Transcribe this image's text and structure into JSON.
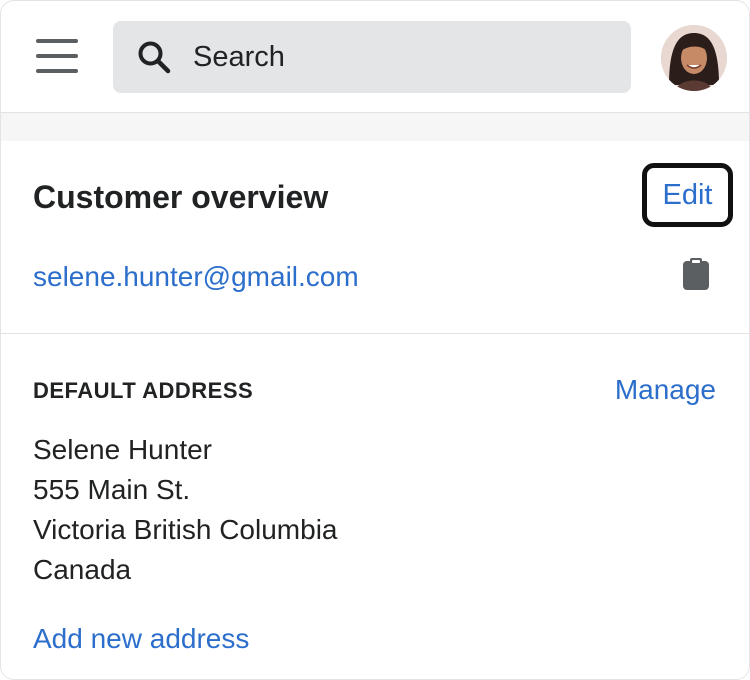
{
  "header": {
    "menu_icon": "hamburger-menu-icon",
    "search": {
      "label": "Search",
      "icon": "search-icon"
    },
    "avatar_icon": "user-avatar"
  },
  "customer_overview": {
    "title": "Customer overview",
    "edit_label": "Edit",
    "email": "selene.hunter@gmail.com",
    "copy_icon": "clipboard-icon"
  },
  "default_address": {
    "heading": "DEFAULT ADDRESS",
    "manage_label": "Manage",
    "lines": [
      "Selene Hunter",
      "555 Main St.",
      "Victoria British Columbia",
      "Canada"
    ],
    "add_label": "Add new address"
  },
  "colors": {
    "link": "#2c6ecb",
    "text": "#202223",
    "search_bg": "#e4e5e7",
    "page_bg": "#f6f6f7",
    "focus_ring": "#111111"
  }
}
